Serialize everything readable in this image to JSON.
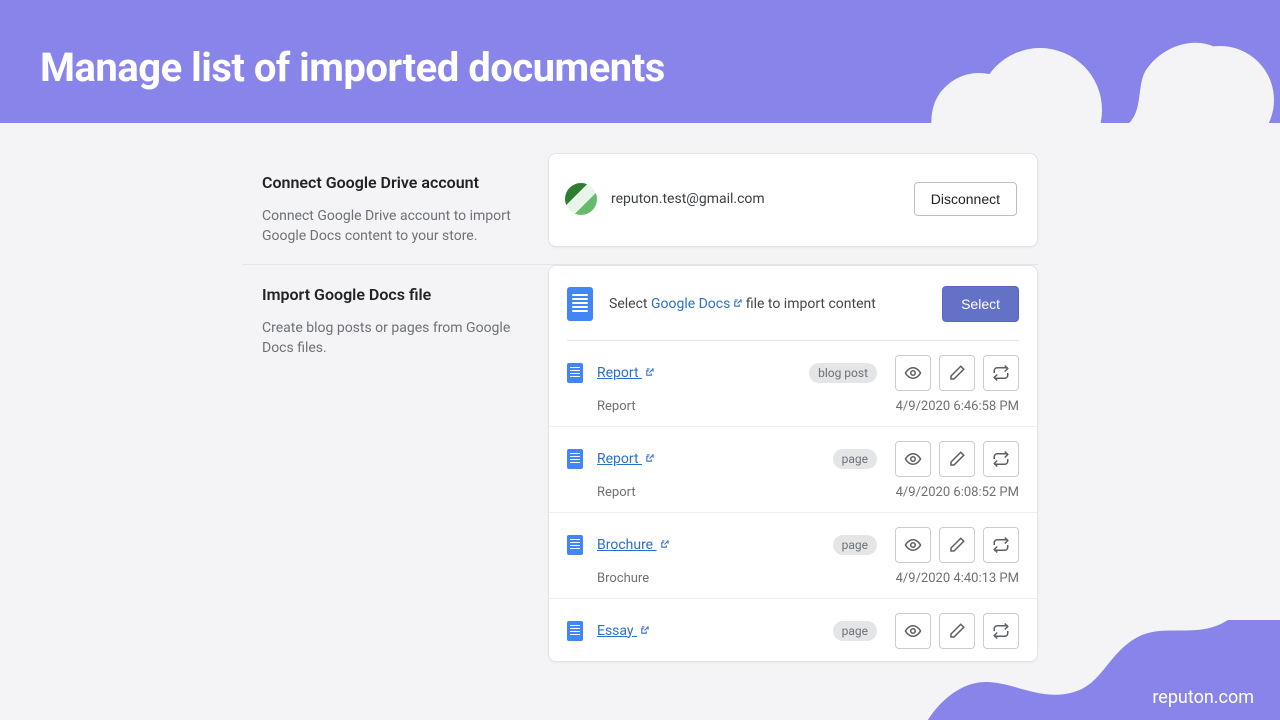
{
  "banner": {
    "title": "Manage list of imported documents"
  },
  "brand": "reputon.com",
  "connect": {
    "title": "Connect Google Drive account",
    "desc": "Connect Google Drive account to import Google Docs content to your store.",
    "email": "reputon.test@gmail.com",
    "disconnect": "Disconnect"
  },
  "import": {
    "title": "Import Google Docs file",
    "desc": "Create blog posts or pages from Google Docs files.",
    "select_prefix": "Select ",
    "select_link": "Google Docs",
    "select_suffix": "  file to import content",
    "select_btn": "Select"
  },
  "docs": [
    {
      "name": "Report",
      "type": "blog post",
      "sub": "Report",
      "time": "4/9/2020 6:46:58 PM"
    },
    {
      "name": "Report",
      "type": "page",
      "sub": "Report",
      "time": "4/9/2020 6:08:52 PM"
    },
    {
      "name": "Brochure",
      "type": "page",
      "sub": "Brochure",
      "time": "4/9/2020 4:40:13 PM"
    },
    {
      "name": "Essay",
      "type": "page",
      "sub": "",
      "time": ""
    }
  ]
}
